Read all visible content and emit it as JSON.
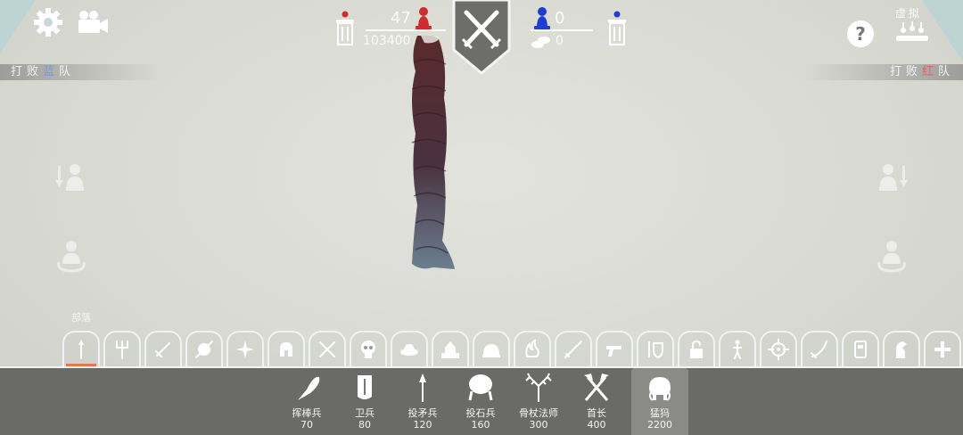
{
  "colors": {
    "accent": "#e07a4a",
    "red_team": "#d12a2a",
    "blue_team": "#1f3ed1",
    "tray_bg": "#6a6a67"
  },
  "top_left": {
    "icons": [
      "gear-icon",
      "camera-icon"
    ]
  },
  "left_panel": {
    "defeat_prefix": "打败",
    "team_word": "蓝",
    "team_suffix": "队"
  },
  "right_panel": {
    "defeat_prefix": "打败",
    "team_word": "红",
    "team_suffix": "队",
    "sim_label": "虚拟"
  },
  "scoreboard": {
    "red": {
      "unit_count": "47",
      "cost": "103400"
    },
    "blue": {
      "unit_count": "0",
      "cost": "0"
    }
  },
  "faction": {
    "name": "部落"
  },
  "faction_tabs": [
    "spear-icon",
    "pitchfork-icon",
    "sword-icon",
    "shield-icon",
    "shuriken-icon",
    "helmet-icon",
    "crossed-swords-icon",
    "skull-icon",
    "hat-icon",
    "castle-icon",
    "dome-icon",
    "flame-icon",
    "rifle-icon",
    "pistol-icon",
    "sword-shield-icon",
    "lock-icon",
    "figure-icon",
    "crosshair-icon",
    "scimitar-icon",
    "robot-icon",
    "knight-icon",
    "plus-icon"
  ],
  "units": [
    {
      "name": "挥棒兵",
      "price": "70",
      "icon": "club-icon"
    },
    {
      "name": "卫兵",
      "price": "80",
      "icon": "guard-shield-icon"
    },
    {
      "name": "投矛兵",
      "price": "120",
      "icon": "spear-icon"
    },
    {
      "name": "投石兵",
      "price": "160",
      "icon": "catapult-icon"
    },
    {
      "name": "骨杖法师",
      "price": "300",
      "icon": "antler-icon"
    },
    {
      "name": "首长",
      "price": "400",
      "icon": "axes-icon"
    },
    {
      "name": "猛犸",
      "price": "2200",
      "icon": "mammoth-icon"
    }
  ]
}
